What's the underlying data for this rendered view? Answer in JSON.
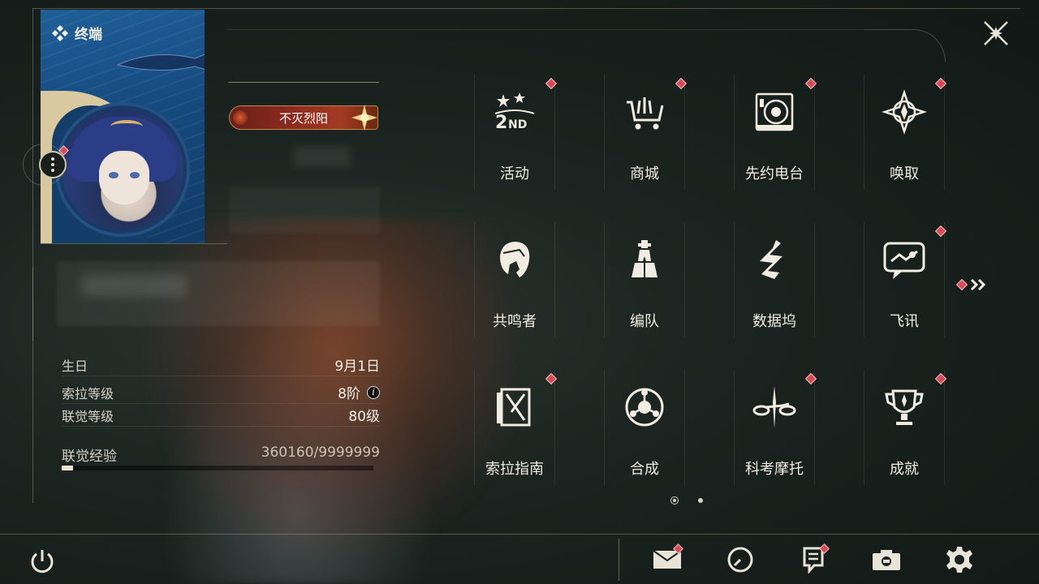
{
  "terminal": {
    "title": "终端",
    "title_badge": "不灭烈阳"
  },
  "stats": {
    "birthday_label": "生日",
    "birthday_value": "9月1日",
    "sola_level_label": "索拉等级",
    "sola_level_value": "8阶",
    "union_level_label": "联觉等级",
    "union_level_value": "80级",
    "union_exp_label": "联觉经验",
    "union_exp_value": "360160/9999999",
    "union_exp_progress": 0.036
  },
  "menu": {
    "items": [
      {
        "label": "活动",
        "icon": "event-icon",
        "badge": true
      },
      {
        "label": "商城",
        "icon": "shop-cart-icon",
        "badge": true
      },
      {
        "label": "先约电台",
        "icon": "radio-icon",
        "badge": true
      },
      {
        "label": "唤取",
        "icon": "convene-icon",
        "badge": true
      },
      {
        "label": "共鸣者",
        "icon": "resonator-icon",
        "badge": false
      },
      {
        "label": "编队",
        "icon": "team-chess-icon",
        "badge": false
      },
      {
        "label": "数据坞",
        "icon": "data-dock-icon",
        "badge": false
      },
      {
        "label": "飞讯",
        "icon": "message-icon",
        "badge": true
      },
      {
        "label": "索拉指南",
        "icon": "guide-book-icon",
        "badge": true
      },
      {
        "label": "合成",
        "icon": "synthesis-icon",
        "badge": false
      },
      {
        "label": "科考摩托",
        "icon": "motorcycle-icon",
        "badge": true
      },
      {
        "label": "成就",
        "icon": "trophy-icon",
        "badge": true
      }
    ],
    "current_page": 1,
    "total_pages": 2
  },
  "colors": {
    "badge": "#d84a58",
    "accent": "#d9c9a0",
    "text": "#f0ece2"
  },
  "bottom_bar": {
    "icons": [
      "power-icon",
      "mail-icon",
      "clock-icon",
      "notice-icon",
      "camera-icon",
      "settings-gear-icon"
    ]
  }
}
